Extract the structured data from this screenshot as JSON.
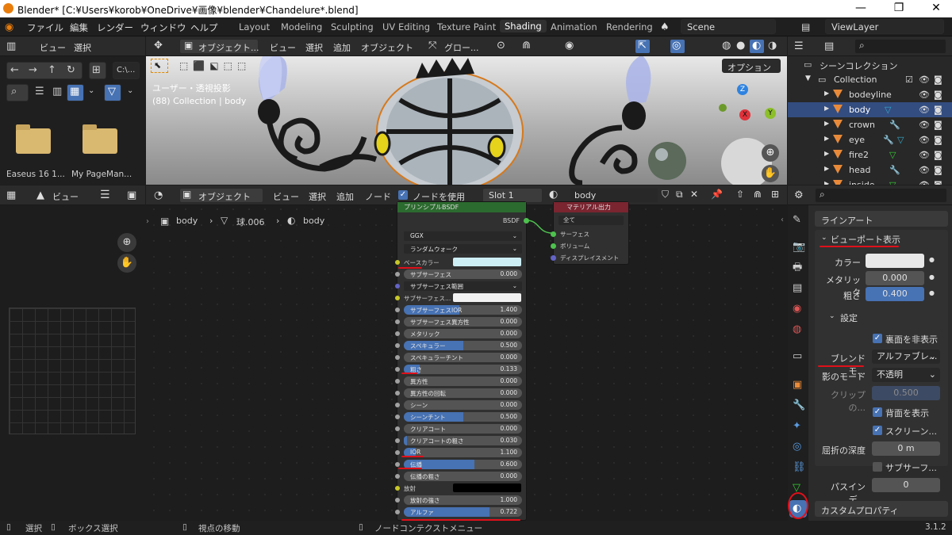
{
  "window": {
    "title": "Blender* [C:¥Users¥korob¥OneDrive¥画像¥blender¥Chandelure*.blend]",
    "minimize": "—",
    "maximize": "❐",
    "close": "✕"
  },
  "menu": {
    "items": [
      "ファイル",
      "編集",
      "レンダー",
      "ウィンドウ",
      "ヘルプ"
    ],
    "workspaces": [
      "Layout",
      "Modeling",
      "Sculpting",
      "UV Editing",
      "Texture Paint",
      "Shading",
      "Animation",
      "Rendering"
    ],
    "active_workspace": "Shading",
    "scene": "Scene",
    "view_layer": "ViewLayer"
  },
  "filebrowser": {
    "view": "ビュー",
    "select": "選択",
    "path": "C:\\...",
    "folders": [
      "Easeus 16 1...",
      "My PageMan..."
    ]
  },
  "viewport": {
    "mode": "オブジェクト...",
    "menus": [
      "ビュー",
      "選択",
      "追加",
      "オブジェクト"
    ],
    "transform": "グロー...",
    "options": "オプション",
    "label1": "ユーザー・透視投影",
    "label2": "(88) Collection | body",
    "gizmo": {
      "x": "X",
      "y": "Y",
      "z": "Z"
    }
  },
  "outliner": {
    "root": "シーンコレクション",
    "collection": "Collection",
    "objects": [
      "bodeyline",
      "body",
      "crown",
      "eye",
      "fire2",
      "head",
      "inside"
    ],
    "selected": "body"
  },
  "node_editor": {
    "mode": "オブジェクト",
    "menus": [
      "ビュー",
      "選択",
      "追加",
      "ノード"
    ],
    "use_nodes": "ノードを使用",
    "slot": "Slot 1",
    "material": "body",
    "breadcrumb": [
      "body",
      "球.006",
      "body"
    ],
    "bsdf_node": {
      "title": "プリンシプルBSDF",
      "output": "BSDF",
      "distribution": "GGX",
      "subsurface_method": "ランダムウォーク",
      "base_color_label": "ベースカラー",
      "subsurface_color_label": "サブサーフェス...",
      "subsurface_radius": "サブサーフェス範囲",
      "emission_label": "放射",
      "fields": [
        {
          "label": "サブサーフェス",
          "value": "0.000",
          "fill": 0
        },
        {
          "label": "サブサーフェスIOR",
          "value": "1.400",
          "fill": 0.47
        },
        {
          "label": "サブサーフェス異方性",
          "value": "0.000",
          "fill": 0
        },
        {
          "label": "メタリック",
          "value": "0.000",
          "fill": 0
        },
        {
          "label": "スペキュラー",
          "value": "0.500",
          "fill": 0.5
        },
        {
          "label": "スペキュラーチント",
          "value": "0.000",
          "fill": 0
        },
        {
          "label": "粗さ",
          "value": "0.133",
          "fill": 0.133
        },
        {
          "label": "異方性",
          "value": "0.000",
          "fill": 0
        },
        {
          "label": "異方性の回転",
          "value": "0.000",
          "fill": 0
        },
        {
          "label": "シーン",
          "value": "0.000",
          "fill": 0
        },
        {
          "label": "シーンチント",
          "value": "0.500",
          "fill": 0.5
        },
        {
          "label": "クリアコート",
          "value": "0.000",
          "fill": 0
        },
        {
          "label": "クリアコートの粗さ",
          "value": "0.030",
          "fill": 0.03
        },
        {
          "label": "IOR",
          "value": "1.100",
          "fill": 0.1
        },
        {
          "label": "伝播",
          "value": "0.600",
          "fill": 0.6
        },
        {
          "label": "伝播の粗さ",
          "value": "0.000",
          "fill": 0
        }
      ],
      "emission_strength": {
        "label": "放射の強さ",
        "value": "1.000"
      },
      "alpha": {
        "label": "アルファ",
        "value": "0.722",
        "fill": 0.722
      }
    },
    "output_node": {
      "title": "マテリアル出力",
      "target": "全て",
      "inputs": [
        "サーフェス",
        "ボリューム",
        "ディスプレイスメント"
      ]
    }
  },
  "properties": {
    "search": "",
    "panels": {
      "lineart": "ラインアート",
      "viewport_display": "ビューポート表示",
      "settings": "設定",
      "custom": "カスタムプロパティ"
    },
    "color_label": "カラー",
    "metallic_label": "メタリック",
    "metallic_value": "0.000",
    "roughness_label": "粗さ",
    "roughness_value": "0.400",
    "backface_culling": "裏面を非表示",
    "blend_mode_label": "ブレンドモ...",
    "blend_mode_value": "アルファブレ...",
    "shadow_mode_label": "影のモード",
    "shadow_mode_value": "不透明",
    "clip_label": "クリップの...",
    "clip_value": "0.500",
    "show_backface": "背面を表示",
    "screen_refraction": "スクリーン...",
    "refraction_depth_label": "屈折の深度",
    "refraction_depth_value": "0 m",
    "subsurface_translucency": "サブサーフ...",
    "pass_index_label": "パスインデ...",
    "pass_index_value": "0"
  },
  "statusbar": {
    "select": "選択",
    "box_select": "ボックス選択",
    "move_view": "視点の移動",
    "node_context": "ノードコンテクストメニュー",
    "version": "3.1.2"
  },
  "colors": {
    "accent": "#4772b3",
    "selection": "#334d80",
    "node_header": "#2c6b2f",
    "output_header": "#7a2530",
    "annotation": "#e0101a"
  }
}
